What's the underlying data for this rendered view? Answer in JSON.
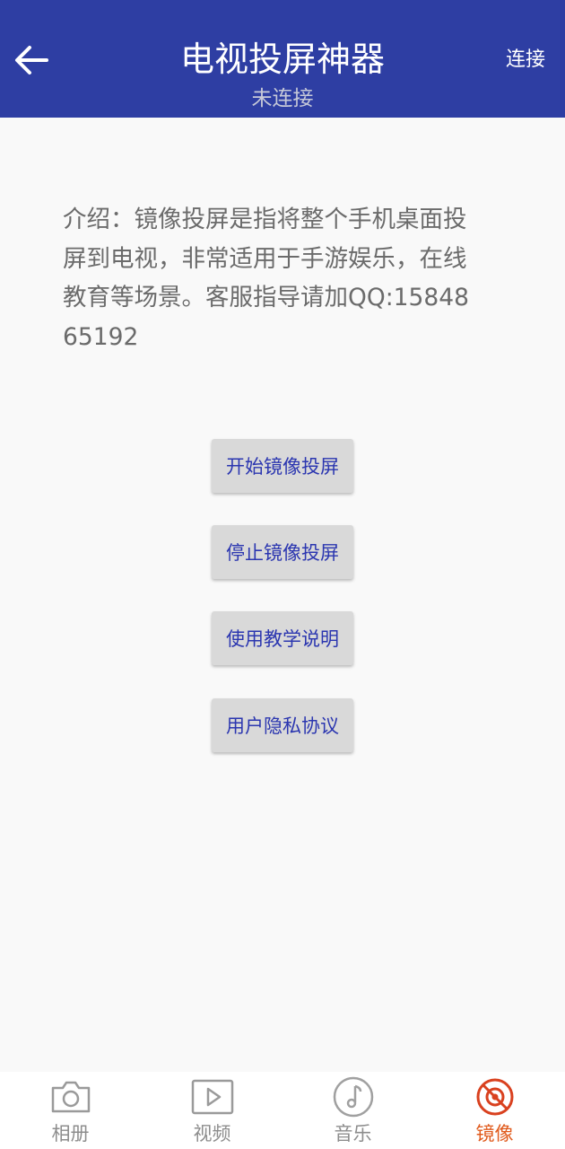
{
  "header": {
    "title": "电视投屏神器",
    "subtitle": "未连接",
    "connect_label": "连接",
    "background_color": "#2e3ea3",
    "back_icon": "arrow-left-icon"
  },
  "intro": {
    "text": "介绍：镜像投屏是指将整个手机桌面投屏到电视，非常适用于手游娱乐，在线教育等场景。客服指导请加QQ:1584865192"
  },
  "actions": {
    "start_label": "开始镜像投屏",
    "stop_label": "停止镜像投屏",
    "tutorial_label": "使用教学说明",
    "privacy_label": "用户隐私协议",
    "text_color": "#2b36b0"
  },
  "tabbar": {
    "active_color": "#e05a1c",
    "items": [
      {
        "label": "相册",
        "icon": "camera-icon"
      },
      {
        "label": "视频",
        "icon": "video-play-icon"
      },
      {
        "label": "音乐",
        "icon": "music-note-icon"
      },
      {
        "label": "镜像",
        "icon": "mirror-cast-icon",
        "active": true
      }
    ]
  }
}
